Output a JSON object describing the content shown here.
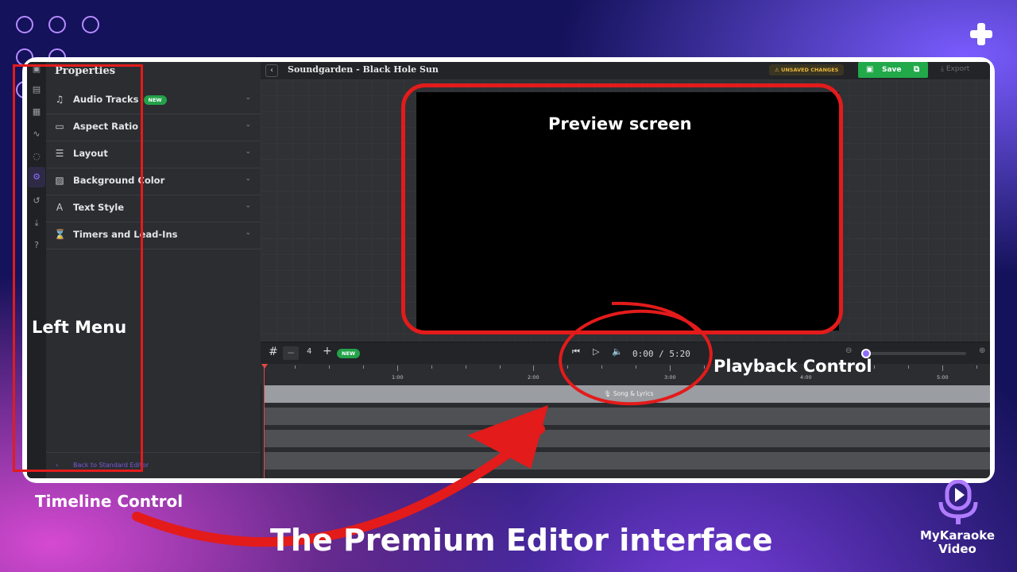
{
  "project": {
    "title": "Soundgarden - Black Hole Sun",
    "unsaved_label": "UNSAVED CHANGES",
    "save_label": "Save",
    "export_label": "Export"
  },
  "sidebar": {
    "title": "Properties",
    "items": [
      {
        "label": "Audio Tracks",
        "icon": "music-note-icon",
        "badge": "NEW"
      },
      {
        "label": "Aspect Ratio",
        "icon": "aspect-ratio-icon"
      },
      {
        "label": "Layout",
        "icon": "layout-icon"
      },
      {
        "label": "Background Color",
        "icon": "background-pattern-icon"
      },
      {
        "label": "Text Style",
        "icon": "text-style-icon"
      },
      {
        "label": "Timers and Lead-Ins",
        "icon": "hourglass-icon"
      }
    ],
    "back_label": "Back to Standard Editor"
  },
  "timeline": {
    "zoom_value": "4",
    "new_badge": "NEW",
    "time_display": "0:00 / 5:20",
    "ruler_labels": [
      "1:00",
      "2:00",
      "3:00",
      "4:00",
      "5:00"
    ],
    "song_track_label": "Song & Lyrics"
  },
  "annotations": {
    "preview": "Preview screen",
    "left_menu": "Left Menu",
    "playback": "Playback Control",
    "timeline": "Timeline Control",
    "headline": "The Premium Editor interface",
    "brand": "MyKaraoke Video"
  },
  "colors": {
    "accent": "#8e6cff",
    "save": "#22a94a",
    "annotation_red": "#e31b1b",
    "background": "#14125a"
  }
}
